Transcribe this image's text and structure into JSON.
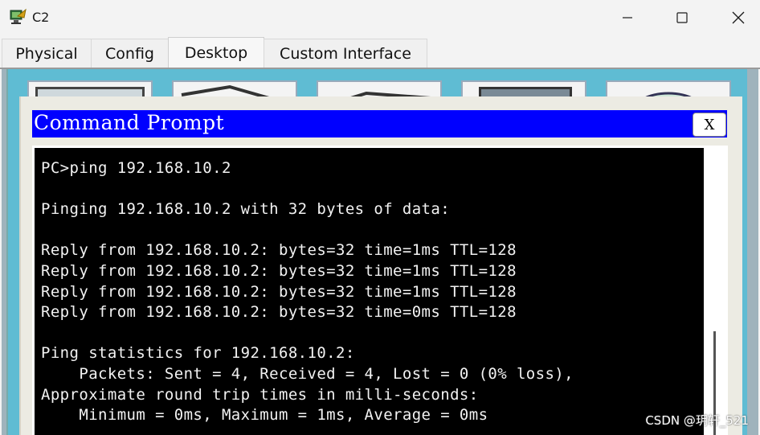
{
  "window": {
    "title": "C2",
    "controls": {
      "minimize": "minimize",
      "maximize": "maximize",
      "close": "close"
    }
  },
  "tabs": [
    {
      "label": "Physical",
      "active": false
    },
    {
      "label": "Config",
      "active": false
    },
    {
      "label": "Desktop",
      "active": true
    },
    {
      "label": "Custom Interface",
      "active": false
    }
  ],
  "desktop": {
    "app_tiles": [
      "ip-config-icon",
      "dial-up-icon",
      "terminal-icon",
      "command-prompt-icon",
      "web-browser-icon"
    ]
  },
  "command_prompt": {
    "title": "Command Prompt",
    "close_label": "X",
    "lines": [
      "PC>ping 192.168.10.2",
      "",
      "Pinging 192.168.10.2 with 32 bytes of data:",
      "",
      "Reply from 192.168.10.2: bytes=32 time=1ms TTL=128",
      "Reply from 192.168.10.2: bytes=32 time=1ms TTL=128",
      "Reply from 192.168.10.2: bytes=32 time=1ms TTL=128",
      "Reply from 192.168.10.2: bytes=32 time=0ms TTL=128",
      "",
      "Ping statistics for 192.168.10.2:",
      "    Packets: Sent = 4, Received = 4, Lost = 0 (0% loss),",
      "Approximate round trip times in milli-seconds:",
      "    Minimum = 0ms, Maximum = 1ms, Average = 0ms"
    ]
  },
  "watermark": "CSDN @玥轩_521",
  "colors": {
    "title_bar_blue": "#0000ff",
    "console_bg": "#000000",
    "console_fg": "#f2f2f2",
    "desktop_bg": "#5fbcd3"
  }
}
